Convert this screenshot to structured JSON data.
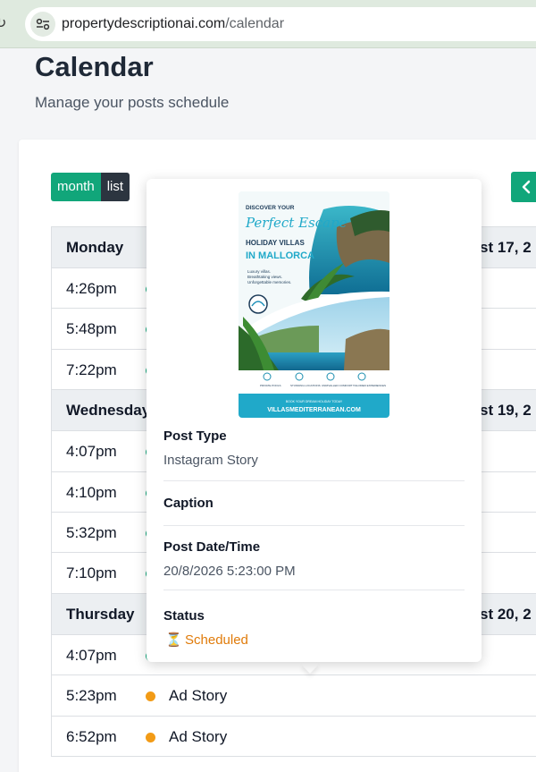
{
  "browser": {
    "url_domain": "propertydescriptionai.com",
    "url_path": "/calendar"
  },
  "header": {
    "title": "Calendar",
    "subtitle": "Manage your posts schedule"
  },
  "toolbar": {
    "month_label": "month",
    "list_label": "list"
  },
  "list": {
    "days": [
      {
        "name": "Monday",
        "date": "st 17, 2",
        "events": [
          {
            "time": "4:26pm",
            "title": "",
            "color": "green"
          },
          {
            "time": "5:48pm",
            "title": "",
            "color": "green"
          },
          {
            "time": "7:22pm",
            "title": "",
            "color": "green"
          }
        ]
      },
      {
        "name": "Wednesday",
        "date": "st 19, 2",
        "events": [
          {
            "time": "4:07pm",
            "title": "",
            "color": "green"
          },
          {
            "time": "4:10pm",
            "title": "",
            "color": "green"
          },
          {
            "time": "5:32pm",
            "title": "",
            "color": "green"
          },
          {
            "time": "7:10pm",
            "title": "",
            "color": "green"
          }
        ]
      },
      {
        "name": "Thursday",
        "date": "st 20, 2",
        "events": [
          {
            "time": "4:07pm",
            "title": "",
            "color": "green"
          },
          {
            "time": "5:23pm",
            "title": "Ad Story",
            "color": "orange"
          },
          {
            "time": "6:52pm",
            "title": "Ad Story",
            "color": "orange"
          }
        ]
      }
    ]
  },
  "popover": {
    "poster": {
      "line1": "DISCOVER YOUR",
      "line2": "Perfect Escape",
      "line3": "HOLIDAY VILLAS",
      "line4": "IN MALLORCA",
      "blurb1": "Luxury villas.",
      "blurb2": "Breathtaking views.",
      "blurb3": "Unforgettable memories.",
      "feature1": "PRIVATE POOLS",
      "feature2": "STUNNING LOCATIONS",
      "feature3": "UNRIVALLED COMFORT",
      "feature4": "TAILORED EXPERIENCES",
      "cta": "BOOK YOUR DREAM HOLIDAY TODAY",
      "website": "VILLASMEDITERRANEAN.COM"
    },
    "post_type_label": "Post Type",
    "post_type_value": "Instagram Story",
    "caption_label": "Caption",
    "post_date_label": "Post Date/Time",
    "post_date_value": "20/8/2026 5:23:00 PM",
    "status_label": "Status",
    "status_value": "Scheduled"
  },
  "colors": {
    "accent": "#11a67a",
    "dark": "#2c3540",
    "orange": "#f29b16",
    "status": "#e07b0a"
  }
}
